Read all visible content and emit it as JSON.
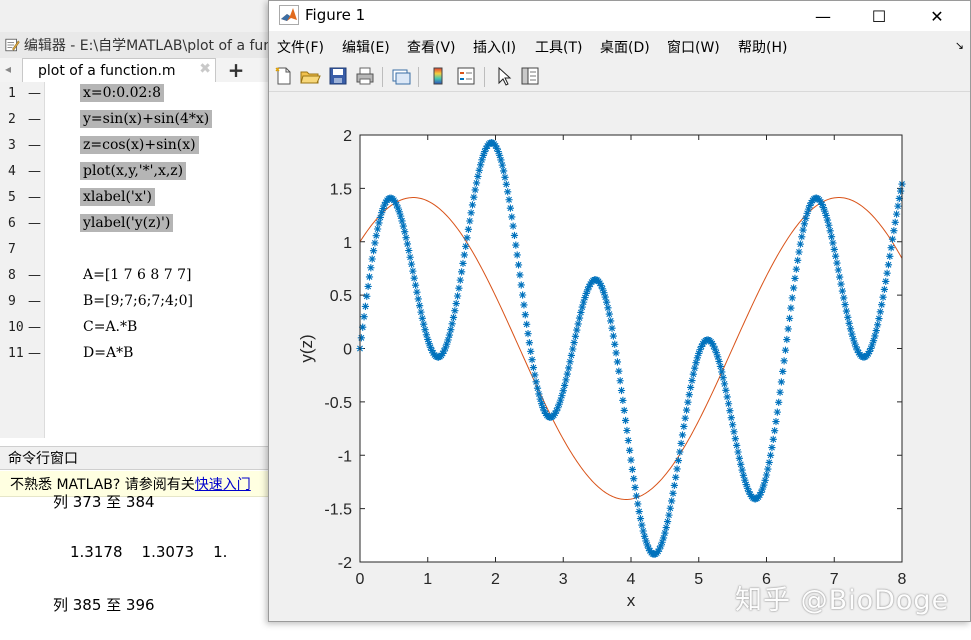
{
  "editor": {
    "title": "编辑器 - E:\\自学MATLAB\\plot of a function.m",
    "tab_label": "plot of a function.m",
    "tab_close": "✖",
    "new_tab": "+",
    "lines": [
      {
        "num": "1",
        "marker": "—",
        "code": "x=0:0.02:8",
        "selected": true
      },
      {
        "num": "2",
        "marker": "—",
        "code": "y=sin(x)+sin(4*x)",
        "selected": true
      },
      {
        "num": "3",
        "marker": "—",
        "code": "z=cos(x)+sin(x)",
        "selected": true
      },
      {
        "num": "4",
        "marker": "—",
        "code": "plot(x,y,'*',x,z)",
        "selected": true
      },
      {
        "num": "5",
        "marker": "—",
        "code": "xlabel('x')",
        "selected": true
      },
      {
        "num": "6",
        "marker": "—",
        "code": "ylabel('y(z)')",
        "selected": true
      },
      {
        "num": "7",
        "marker": "",
        "code": "",
        "selected": false
      },
      {
        "num": "8",
        "marker": "—",
        "code": "A=[1 7 6 8 7 7]",
        "selected": false
      },
      {
        "num": "9",
        "marker": "—",
        "code": "B=[9;7;6;7;4;0]",
        "selected": false
      },
      {
        "num": "10",
        "marker": "—",
        "code": "C=A.*B",
        "selected": false
      },
      {
        "num": "11",
        "marker": "—",
        "code": "D=A*B",
        "selected": false
      }
    ]
  },
  "command_window": {
    "title": "命令行窗口",
    "notice_text": "不熟悉 MATLAB? 请参阅有关",
    "notice_link": "快速入门",
    "output_line1": "列 373 至 384",
    "output_line2": "1.3178    1.3073    1.",
    "output_line3": "列 385 至 396"
  },
  "figure": {
    "title": "Figure 1",
    "controls": {
      "minimize": "—",
      "maximize": "☐",
      "close": "✕"
    },
    "menu": [
      "文件(F)",
      "编辑(E)",
      "查看(V)",
      "插入(I)",
      "工具(T)",
      "桌面(D)",
      "窗口(W)",
      "帮助(H)"
    ],
    "menu_overflow": "↘",
    "toolbar": [
      "new-figure-icon",
      "open-file-icon",
      "save-icon",
      "print-icon",
      "link-plot-icon",
      "colorbar-icon",
      "legend-icon",
      "edit-plot-cursor-icon",
      "property-inspector-icon"
    ]
  },
  "chart_data": {
    "type": "line",
    "xlabel": "x",
    "ylabel": "y(z)",
    "xlim": [
      0,
      8
    ],
    "ylim": [
      -2,
      2
    ],
    "xticks": [
      0,
      1,
      2,
      3,
      4,
      5,
      6,
      7,
      8
    ],
    "yticks": [
      -2,
      -1.5,
      -1,
      -0.5,
      0,
      0.5,
      1,
      1.5,
      2
    ],
    "xtick_labels": [
      "0",
      "1",
      "2",
      "3",
      "4",
      "5",
      "6",
      "7",
      "8"
    ],
    "ytick_labels": [
      "-2",
      "-1.5",
      "-1",
      "-0.5",
      "0",
      "0.5",
      "1",
      "1.5",
      "2"
    ],
    "grid": false,
    "x_range": {
      "start": 0,
      "stop": 8,
      "step": 0.02
    },
    "series": [
      {
        "expression": "sin(x)+sin(4*x)",
        "marker": "*",
        "color": "#0072bd"
      },
      {
        "expression": "cos(x)+sin(x)",
        "marker": "none",
        "color": "#d95319"
      }
    ]
  },
  "watermark": "知乎 @BioDoge"
}
